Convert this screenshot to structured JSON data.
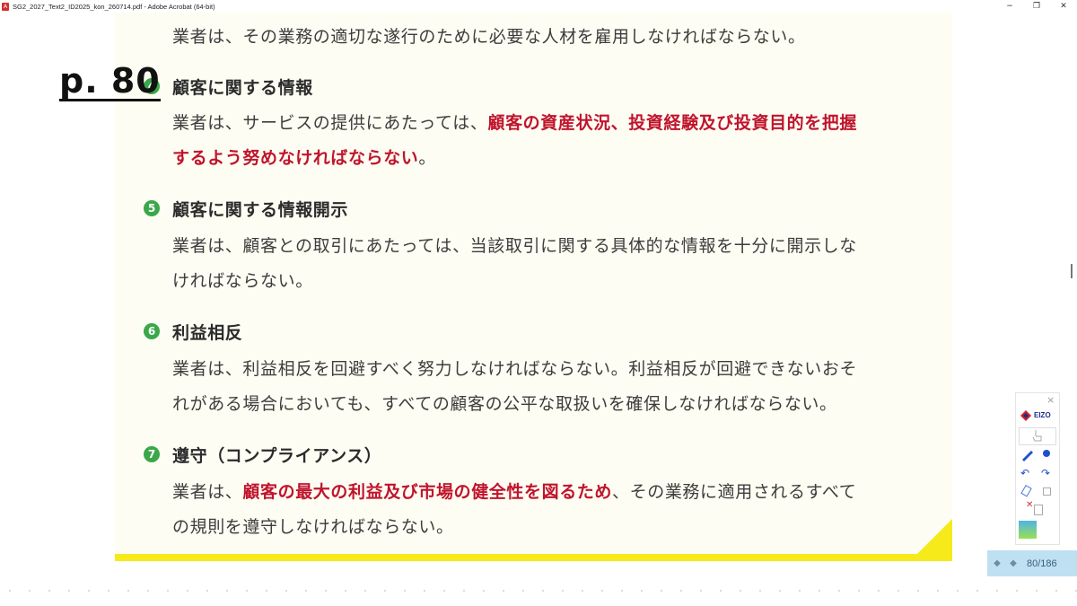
{
  "window": {
    "title": "SG2_2027_Text2_ID2025_kon_260714.pdf - Adobe Acrobat (64-bit)",
    "minimize": "−",
    "maximize": "❐",
    "close": "✕"
  },
  "page_label": "p. 80",
  "content": {
    "top_line": "業者は、その業務の適切な遂行のために必要な人材を雇用しなければならない。",
    "s4": {
      "num": "4",
      "heading": "顧客に関する情報",
      "l1_pre": "業者は、サービスの提供にあたっては、",
      "l1_red": "顧客の資産状況、投資経験及び投資目的を把握",
      "l2_red": "するよう努めなければならない",
      "l2_post": "。"
    },
    "s5": {
      "num": "5",
      "heading": "顧客に関する情報開示",
      "l1": "業者は、顧客との取引にあたっては、当該取引に関する具体的な情報を十分に開示しな",
      "l2": "ければならない。"
    },
    "s6": {
      "num": "6",
      "heading": "利益相反",
      "l1": "業者は、利益相反を回避すべく努力しなければならない。利益相反が回避できないおそ",
      "l2": "れがある場合においても、すべての顧客の公平な取扱いを確保しなければならない。"
    },
    "s7": {
      "num": "7",
      "heading": "遵守（コンプライアンス）",
      "l1_pre": "業者は、",
      "l1_red": "顧客の最大の利益及び市場の健全性を図るため",
      "l1_post": "、その業務に適用されるすべて",
      "l2": "の規則を遵守しなければならない。"
    }
  },
  "tool_panel": {
    "close": "×",
    "logo": "EIZO"
  },
  "page_indicator": "80/186",
  "colors": {
    "accent_red": "#c0142c",
    "number_green": "#3aa84a",
    "page_bg": "#fdfdf3",
    "yellow_band": "#f6ea1a"
  }
}
